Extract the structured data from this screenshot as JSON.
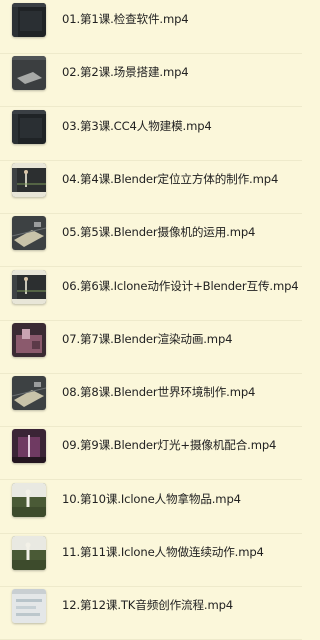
{
  "files": [
    {
      "name": "01.第1课.检查软件.mp4",
      "thumb": "dark-editor-thumbnail"
    },
    {
      "name": "02.第2课.场景搭建.mp4",
      "thumb": "scene-plane-thumbnail"
    },
    {
      "name": "03.第3课.CC4人物建模.mp4",
      "thumb": "dark-editor-thumbnail"
    },
    {
      "name": "04.第4课.Blender定位立方体的制作.mp4",
      "thumb": "figure-viewport-thumbnail"
    },
    {
      "name": "05.第5课.Blender摄像机的运用.mp4",
      "thumb": "camera-plane-thumbnail"
    },
    {
      "name": "06.第6课.Iclone动作设计+Blender互传.mp4",
      "thumb": "figure-viewport-thumbnail"
    },
    {
      "name": "07.第7课.Blender渲染动画.mp4",
      "thumb": "pink-render-thumbnail"
    },
    {
      "name": "08.第8课.Blender世界环境制作.mp4",
      "thumb": "camera-plane-thumbnail"
    },
    {
      "name": "09.第9课.Blender灯光+摄像机配合.mp4",
      "thumb": "purple-light-thumbnail"
    },
    {
      "name": "10.第10课.Iclone人物拿物品.mp4",
      "thumb": "figure-ground-thumbnail"
    },
    {
      "name": "11.第11课.Iclone人物做连续动作.mp4",
      "thumb": "figure-ground-thumbnail"
    },
    {
      "name": "12.第12课.TK音频创作流程.mp4",
      "thumb": "light-ui-thumbnail"
    }
  ]
}
